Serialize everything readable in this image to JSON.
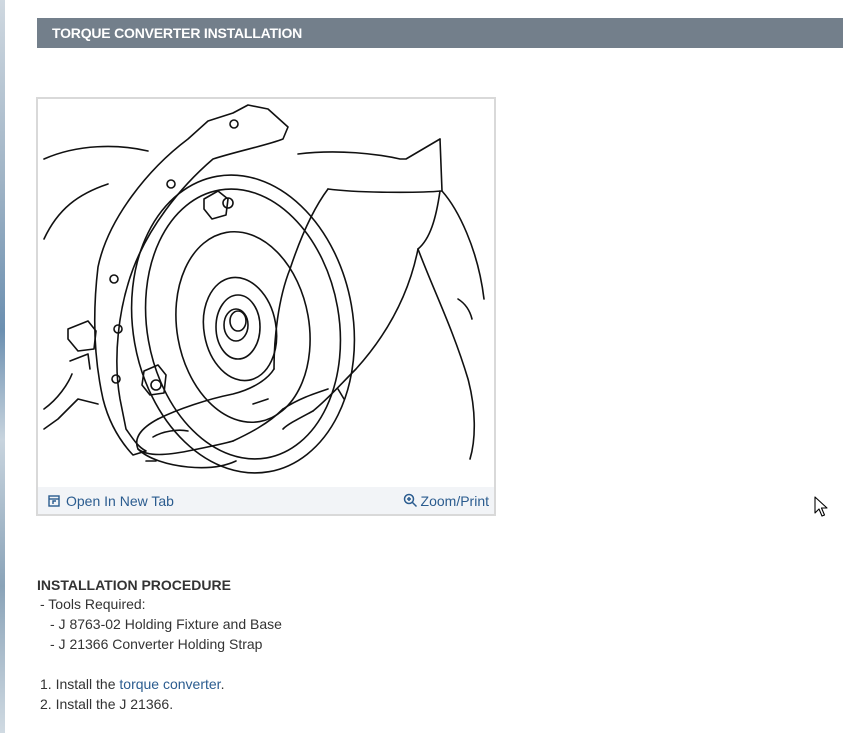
{
  "section": {
    "title": "TORQUE CONVERTER INSTALLATION"
  },
  "figure": {
    "open_tab_label": "Open In New Tab",
    "zoom_label": "Zoom/Print"
  },
  "procedure": {
    "title": "INSTALLATION PROCEDURE",
    "tools_label": "-  Tools Required:",
    "tools": [
      "-  J 8763-02 Holding Fixture and Base",
      "-  J 21366 Converter Holding Strap"
    ],
    "step1_prefix": "1. Install the ",
    "step1_link": "torque converter",
    "step1_suffix": ".",
    "step2": "2. Install the J 21366."
  },
  "colors": {
    "header_bg": "#737f8b",
    "link": "#2b5c8f",
    "figure_bar_bg": "#f2f4f7"
  },
  "icons": {
    "open_tab": "open-in-new-tab-icon",
    "zoom": "zoom-in-icon",
    "cursor": "mouse-pointer-icon"
  }
}
